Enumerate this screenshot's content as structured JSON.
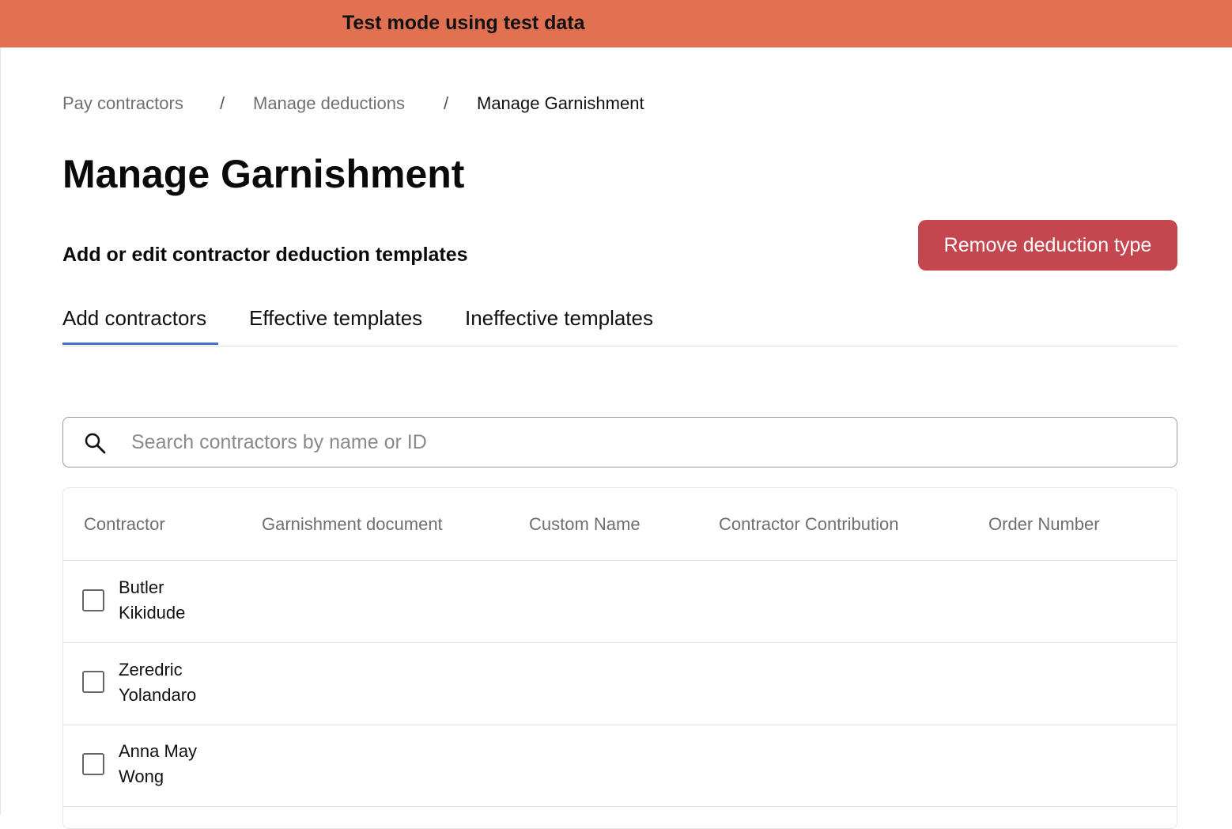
{
  "banner": {
    "text": "Test mode using test data",
    "color": "#e17150"
  },
  "breadcrumb": {
    "items": [
      "Pay contractors",
      "Manage deductions"
    ],
    "separator": "/",
    "current": "Manage Garnishment"
  },
  "page": {
    "title": "Manage Garnishment",
    "subtitle": "Add or edit contractor deduction templates"
  },
  "actions": {
    "remove_label": "Remove deduction type",
    "remove_color": "#c4464e"
  },
  "tabs": {
    "items": [
      "Add contractors",
      "Effective templates",
      "Ineffective templates"
    ],
    "active": "Add contractors",
    "accent": "#4a6fd6"
  },
  "search": {
    "placeholder": "Search contractors by name or ID",
    "value": "",
    "icon": "search-icon"
  },
  "table": {
    "columns": [
      "Contractor",
      "Garnishment document",
      "Custom Name",
      "Contractor Contribution",
      "Order Number"
    ],
    "rows": [
      {
        "first": "Butler",
        "last": "Kikidude",
        "checked": false
      },
      {
        "first": "Zeredric",
        "last": "Yolandaro",
        "checked": false
      },
      {
        "first": "Anna May",
        "last": "Wong",
        "checked": false
      }
    ]
  }
}
